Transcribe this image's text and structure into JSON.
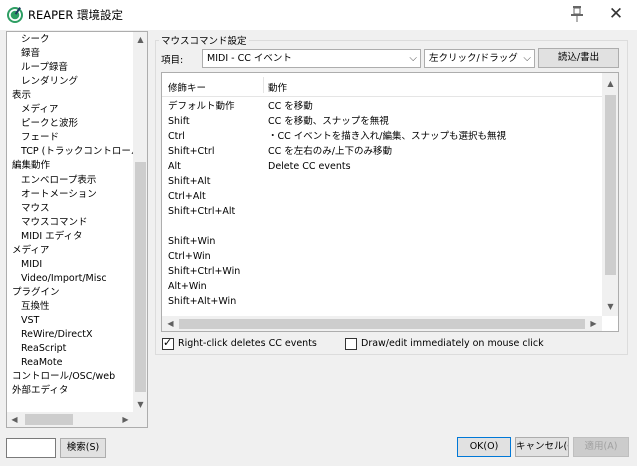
{
  "window": {
    "title": "REAPER 環境設定"
  },
  "tree": {
    "items": [
      {
        "label": "シーク",
        "indent": 1
      },
      {
        "label": "録音",
        "indent": 1
      },
      {
        "label": "ループ録音",
        "indent": 1
      },
      {
        "label": "レンダリング",
        "indent": 1
      },
      {
        "label": "表示",
        "indent": 0
      },
      {
        "label": "メディア",
        "indent": 1
      },
      {
        "label": "ピークと波形",
        "indent": 1
      },
      {
        "label": "フェード",
        "indent": 1
      },
      {
        "label": "TCP (トラックコントロール",
        "indent": 1
      },
      {
        "label": "編集動作",
        "indent": 0
      },
      {
        "label": "エンベロープ表示",
        "indent": 1
      },
      {
        "label": "オートメーション",
        "indent": 1
      },
      {
        "label": "マウス",
        "indent": 1
      },
      {
        "label": "マウスコマンド",
        "indent": 1
      },
      {
        "label": "MIDI エディタ",
        "indent": 1
      },
      {
        "label": "メディア",
        "indent": 0
      },
      {
        "label": "MIDI",
        "indent": 1
      },
      {
        "label": "Video/Import/Misc",
        "indent": 1
      },
      {
        "label": "プラグイン",
        "indent": 0
      },
      {
        "label": "互換性",
        "indent": 1
      },
      {
        "label": "VST",
        "indent": 1
      },
      {
        "label": "ReWire/DirectX",
        "indent": 1
      },
      {
        "label": "ReaScript",
        "indent": 1
      },
      {
        "label": "ReaMote",
        "indent": 1
      },
      {
        "label": "コントロール/OSC/web",
        "indent": 0
      },
      {
        "label": "外部エディタ",
        "indent": 0
      }
    ]
  },
  "search": {
    "value": "",
    "button_label": "検索(S)"
  },
  "mouse_commands": {
    "group_title": "マウスコマンド設定",
    "context_label": "項目:",
    "context_value": "MIDI - CC イベント",
    "action_type_value": "左クリック/ドラッグ",
    "load_save_label": "読込/書出",
    "columns": {
      "modifier": "修飾キー",
      "action": "動作"
    },
    "rows": [
      {
        "modifier": "デフォルト動作",
        "action": "CC を移動"
      },
      {
        "modifier": "Shift",
        "action": "CC を移動、スナップを無視"
      },
      {
        "modifier": "Ctrl",
        "action": "・CC イベントを描き入れ/編集、スナップも選択も無視"
      },
      {
        "modifier": "Shift+Ctrl",
        "action": "CC を左右のみ/上下のみ移動"
      },
      {
        "modifier": "Alt",
        "action": "Delete CC events"
      },
      {
        "modifier": "Shift+Alt",
        "action": ""
      },
      {
        "modifier": "Ctrl+Alt",
        "action": ""
      },
      {
        "modifier": "Shift+Ctrl+Alt",
        "action": ""
      },
      {
        "modifier": "",
        "action": ""
      },
      {
        "modifier": "Shift+Win",
        "action": ""
      },
      {
        "modifier": "Ctrl+Win",
        "action": ""
      },
      {
        "modifier": "Shift+Ctrl+Win",
        "action": ""
      },
      {
        "modifier": "Alt+Win",
        "action": ""
      },
      {
        "modifier": "Shift+Alt+Win",
        "action": ""
      }
    ],
    "right_click_deletes": {
      "label": "Right-click deletes CC events",
      "checked": true
    },
    "draw_edit_immediately": {
      "label": "Draw/edit immediately on mouse click",
      "checked": false
    }
  },
  "footer": {
    "ok_label": "OK(O)",
    "cancel_label": "キャンセル(C)",
    "apply_label": "適用(A)"
  },
  "colors": {
    "accent": "#0078d7",
    "window_bg": "#f0f0f0",
    "text": "#000000"
  }
}
